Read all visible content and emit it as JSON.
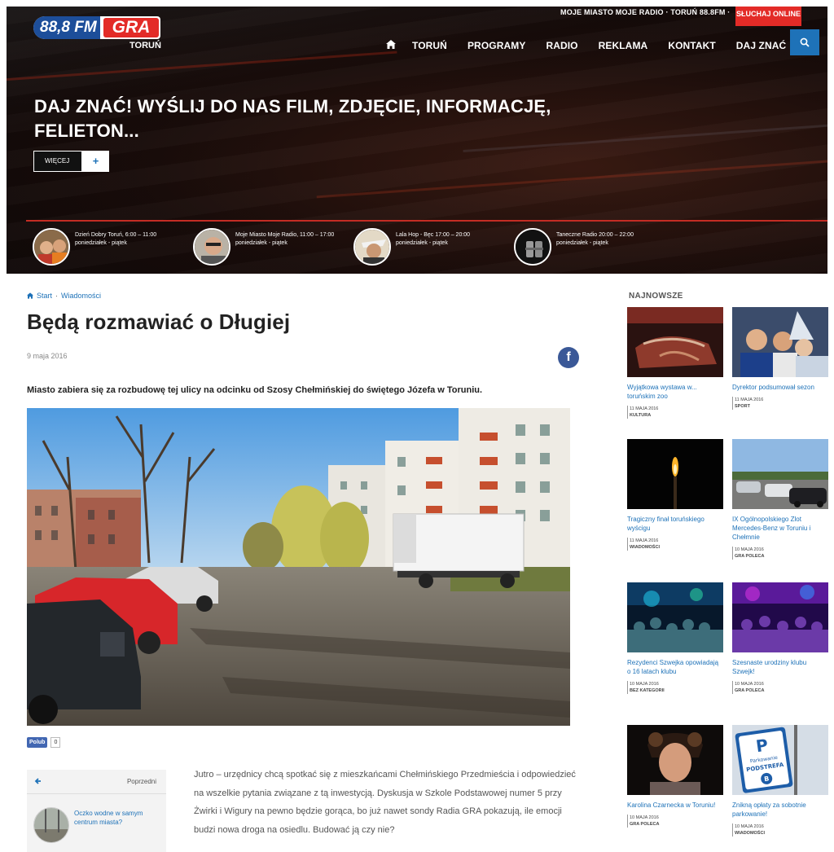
{
  "header": {
    "logo": {
      "freq": "88,8 FM",
      "brand": "GRA",
      "city": "TORUŃ"
    },
    "tagline": "MOJE MIASTO MOJE RADIO · TORUŃ 88.8FM ·",
    "listen_label": "SŁUCHAJ ONLINE",
    "nav": [
      "TORUŃ",
      "PROGRAMY",
      "RADIO",
      "REKLAMA",
      "KONTAKT",
      "DAJ ZNAĆ"
    ]
  },
  "hero": {
    "title": "DAJ ZNAĆ! WYŚLIJ DO NAS FILM, ZDJĘCIE, INFORMACJĘ, FELIETON...",
    "more_label": "WIĘCEJ",
    "more_plus": "+"
  },
  "shows": [
    {
      "name": "Dzień Dobry Toruń, 6:00 – 11:00",
      "days": "poniedziałek - piątek"
    },
    {
      "name": "Moje Miasto Moje Radio, 11:00 – 17:00 poniedziałek - piątek",
      "days": ""
    },
    {
      "name": "Lala Hop - Bęc 17:00 – 20:00",
      "days": "poniedziałek - piątek"
    },
    {
      "name": "Taneczne Radio 20:00 – 22:00",
      "days": "poniedziałek - piątek"
    }
  ],
  "breadcrumb": {
    "start": "Start",
    "section": "Wiadomości"
  },
  "article": {
    "title": "Będą rozmawiać o Długiej",
    "date": "9 maja 2016",
    "lead": "Miasto zabiera się za rozbudowę tej ulicy na odcinku od Szosy Chełmińskiej do świętego Józefa w Toruniu.",
    "body": "Jutro – urzędnicy chcą spotkać się z mieszkańcami Chełmińskiego Przedmieścia i odpowiedzieć na wszelkie pytania związane z tą inwestycją. Dyskusja w Szkole Podstawowej numer 5 przy Żwirki i Wigury na pewno będzie gorąca, bo już nawet sondy Radia GRA pokazują, ile emocji budzi nowa droga na osiedlu. Budować ją czy nie?",
    "like_label": "Polub",
    "like_count": "0",
    "fb_letter": "f"
  },
  "prev": {
    "label": "Poprzedni",
    "title": "Oczko wodne w samym centrum miasta?"
  },
  "sidebar": {
    "heading": "NAJNOWSZE",
    "items": [
      {
        "title": "Wyjątkowa wystawa w... toruńskim zoo",
        "date": "11 MAJA 2016",
        "category": "KULTURA"
      },
      {
        "title": "Dyrektor podsumował sezon",
        "date": "11 MAJA 2016",
        "category": "SPORT"
      },
      {
        "title": "Tragiczny finał toruńskiego wyścigu",
        "date": "11 MAJA 2016",
        "category": "WIADOMOŚCI"
      },
      {
        "title": "IX Ogólnopolskiego Zlot Mercedes-Benz w Toruniu i Chełmnie",
        "date": "10 MAJA 2016",
        "category": "GRA POLECA"
      },
      {
        "title": "Rezydenci Szwejka opowiadają o 16 latach klubu",
        "date": "10 MAJA 2016",
        "category": "BEZ KATEGORII"
      },
      {
        "title": "Szesnaste urodziny klubu Szwejk!",
        "date": "10 MAJA 2016",
        "category": "GRA POLECA"
      },
      {
        "title": "Karolina Czarnecka w Toruniu!",
        "date": "10 MAJA 2016",
        "category": "GRA POLECA"
      },
      {
        "title": "Znikną opłaty za sobotnie parkowanie!",
        "date": "10 MAJA 2016",
        "category": "WIADOMOŚCI"
      }
    ]
  },
  "parking_sign": {
    "letter": "P",
    "line1": "Parkowanie",
    "line2": "PODSTREFA",
    "zone": "B"
  },
  "colors": {
    "accent_red": "#e32b27",
    "accent_blue": "#1e72b8",
    "link_blue": "#1e72b8"
  }
}
